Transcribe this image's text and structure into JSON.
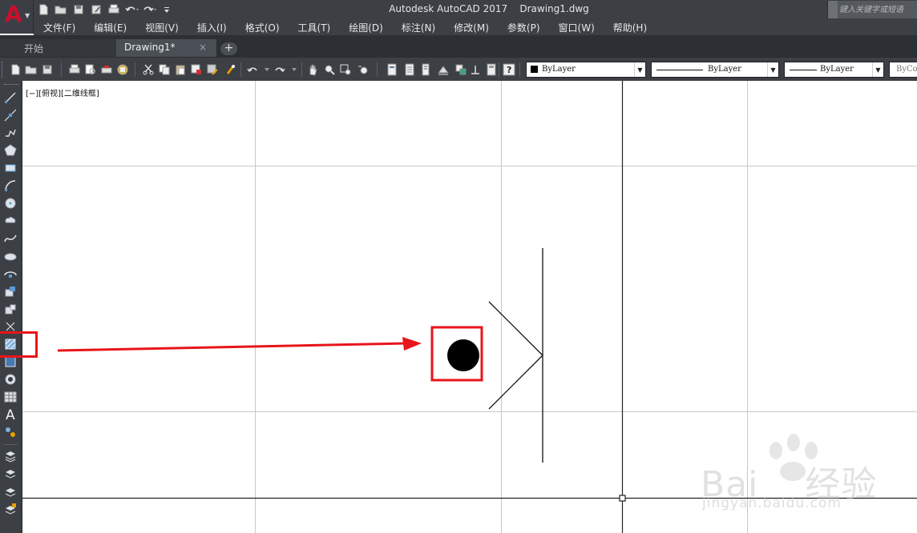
{
  "app": {
    "logo_letter": "A",
    "window_title": "Autodesk AutoCAD 2017    Drawing1.dwg",
    "search_placeholder": "键入关键字或短语"
  },
  "menu": [
    "文件(F)",
    "编辑(E)",
    "视图(V)",
    "插入(I)",
    "格式(O)",
    "工具(T)",
    "绘图(D)",
    "标注(N)",
    "修改(M)",
    "参数(P)",
    "窗口(W)",
    "帮助(H)"
  ],
  "tabs": {
    "start": "开始",
    "drawing": "Drawing1*",
    "close_glyph": "×",
    "new_glyph": "+"
  },
  "toolbar": {
    "color_combo": "ByLayer",
    "linetype_combo": "ByLayer",
    "lineweight_combo": "ByLayer",
    "plotstyle_combo": "ByColor"
  },
  "canvas": {
    "viewport_label": "[−][俯视][二维线框]"
  },
  "watermark": {
    "text": "Bai",
    "text2": "经验",
    "sub": "jingyan.baidu.com"
  },
  "colors": {
    "annotation": "#e8151a",
    "ui_dark": "#3c3f44",
    "logo_red": "#c8102e"
  }
}
